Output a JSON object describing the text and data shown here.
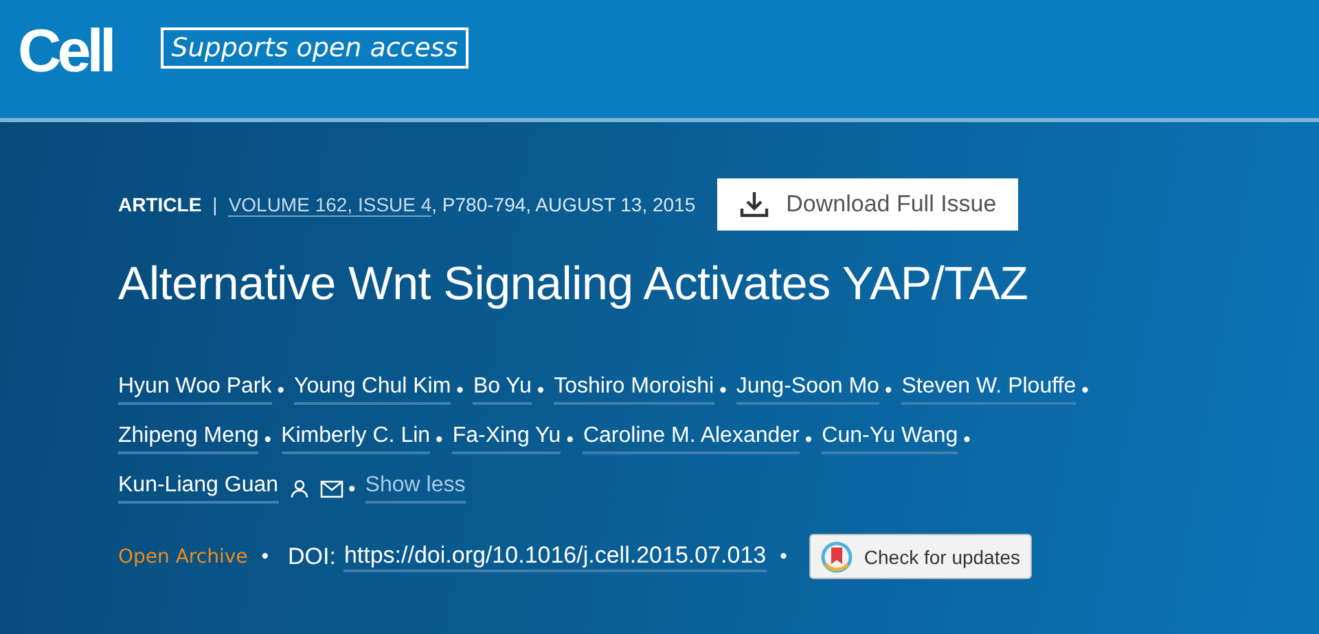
{
  "header": {
    "logo": "Cell",
    "badge": "Supports open access"
  },
  "meta": {
    "type": "ARTICLE",
    "divider": "|",
    "volume_link": "VOLUME 162, ISSUE 4",
    "pages_date": ", P780-794, AUGUST 13, 2015",
    "download_button": "Download Full Issue"
  },
  "title": "Alternative Wnt Signaling Activates YAP/TAZ",
  "authors": [
    {
      "name": "Hyun Woo Park",
      "corresponding": false,
      "separator": "•"
    },
    {
      "name": "Young Chul Kim",
      "corresponding": false,
      "separator": "•"
    },
    {
      "name": "Bo Yu",
      "corresponding": false,
      "separator": "•"
    },
    {
      "name": "Toshiro Moroishi",
      "corresponding": false,
      "separator": "•"
    },
    {
      "name": "Jung-Soon Mo",
      "corresponding": false,
      "separator": "•"
    },
    {
      "name": "Steven W. Plouffe",
      "corresponding": false,
      "separator": "•"
    },
    {
      "name": "Zhipeng Meng",
      "corresponding": false,
      "separator": "•"
    },
    {
      "name": "Kimberly C. Lin",
      "corresponding": false,
      "separator": "•"
    },
    {
      "name": "Fa-Xing Yu",
      "corresponding": false,
      "separator": "•"
    },
    {
      "name": "Caroline M. Alexander",
      "corresponding": false,
      "separator": "•"
    },
    {
      "name": "Cun-Yu Wang",
      "corresponding": false,
      "separator": "•"
    },
    {
      "name": "Kun-Liang Guan",
      "corresponding": true,
      "separator": "•"
    }
  ],
  "show_less": "Show less",
  "footer": {
    "access": "Open Archive",
    "separator_1": "•",
    "doi_label": "DOI:",
    "doi_link": "https://doi.org/10.1016/j.cell.2015.07.013",
    "separator_2": "•",
    "updates_button": "Check for updates"
  }
}
